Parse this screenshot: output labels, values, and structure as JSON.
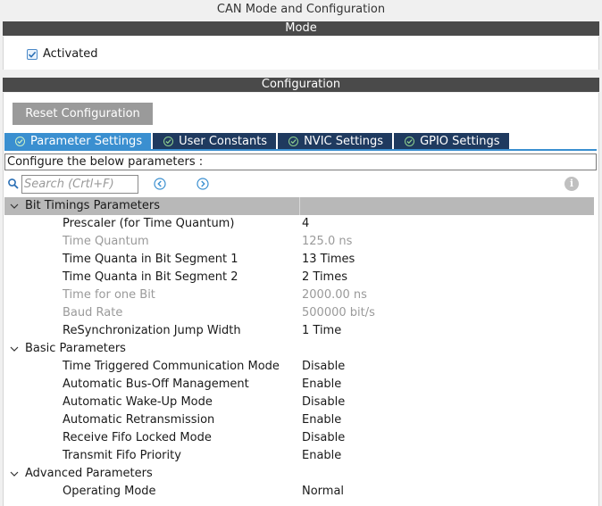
{
  "window": {
    "title": "CAN Mode and Configuration"
  },
  "mode": {
    "header": "Mode",
    "activated_label": "Activated",
    "activated_checked": true
  },
  "configuration": {
    "header": "Configuration",
    "reset_label": "Reset Configuration",
    "tabs": [
      {
        "label": "Parameter Settings",
        "active": true,
        "icon": "check-circle-icon"
      },
      {
        "label": "User Constants",
        "active": false,
        "icon": "check-circle-icon"
      },
      {
        "label": "NVIC Settings",
        "active": false,
        "icon": "check-circle-icon"
      },
      {
        "label": "GPIO Settings",
        "active": false,
        "icon": "check-circle-icon"
      }
    ],
    "configure_text": "Configure the below parameters :",
    "search": {
      "placeholder": "Search (Crtl+F)",
      "value": ""
    },
    "groups": [
      {
        "label": "Bit Timings Parameters",
        "expanded": true,
        "params": [
          {
            "name": "Prescaler (for Time Quantum)",
            "value": "4",
            "disabled": false
          },
          {
            "name": "Time Quantum",
            "value": "125.0 ns",
            "disabled": true
          },
          {
            "name": "Time Quanta in Bit Segment 1",
            "value": "13 Times",
            "disabled": false
          },
          {
            "name": "Time Quanta in Bit Segment 2",
            "value": "2 Times",
            "disabled": false
          },
          {
            "name": "Time for one Bit",
            "value": "2000.00 ns",
            "disabled": true
          },
          {
            "name": "Baud Rate",
            "value": "500000 bit/s",
            "disabled": true
          },
          {
            "name": "ReSynchronization Jump Width",
            "value": "1 Time",
            "disabled": false
          }
        ]
      },
      {
        "label": "Basic Parameters",
        "expanded": true,
        "params": [
          {
            "name": "Time Triggered Communication Mode",
            "value": "Disable",
            "disabled": false
          },
          {
            "name": "Automatic Bus-Off Management",
            "value": "Enable",
            "disabled": false
          },
          {
            "name": "Automatic Wake-Up Mode",
            "value": "Disable",
            "disabled": false
          },
          {
            "name": "Automatic Retransmission",
            "value": "Enable",
            "disabled": false
          },
          {
            "name": "Receive Fifo Locked Mode",
            "value": "Disable",
            "disabled": false
          },
          {
            "name": "Transmit Fifo Priority",
            "value": "Enable",
            "disabled": false
          }
        ]
      },
      {
        "label": "Advanced Parameters",
        "expanded": true,
        "params": [
          {
            "name": "Operating Mode",
            "value": "Normal",
            "disabled": false
          }
        ]
      }
    ]
  },
  "colors": {
    "section_bar": "#4a4a4a",
    "tab_active": "#3a8fd0",
    "tab_inactive": "#1f3a5f",
    "group_highlight": "#b8b8b8",
    "disabled_text": "#9a9a9a"
  }
}
